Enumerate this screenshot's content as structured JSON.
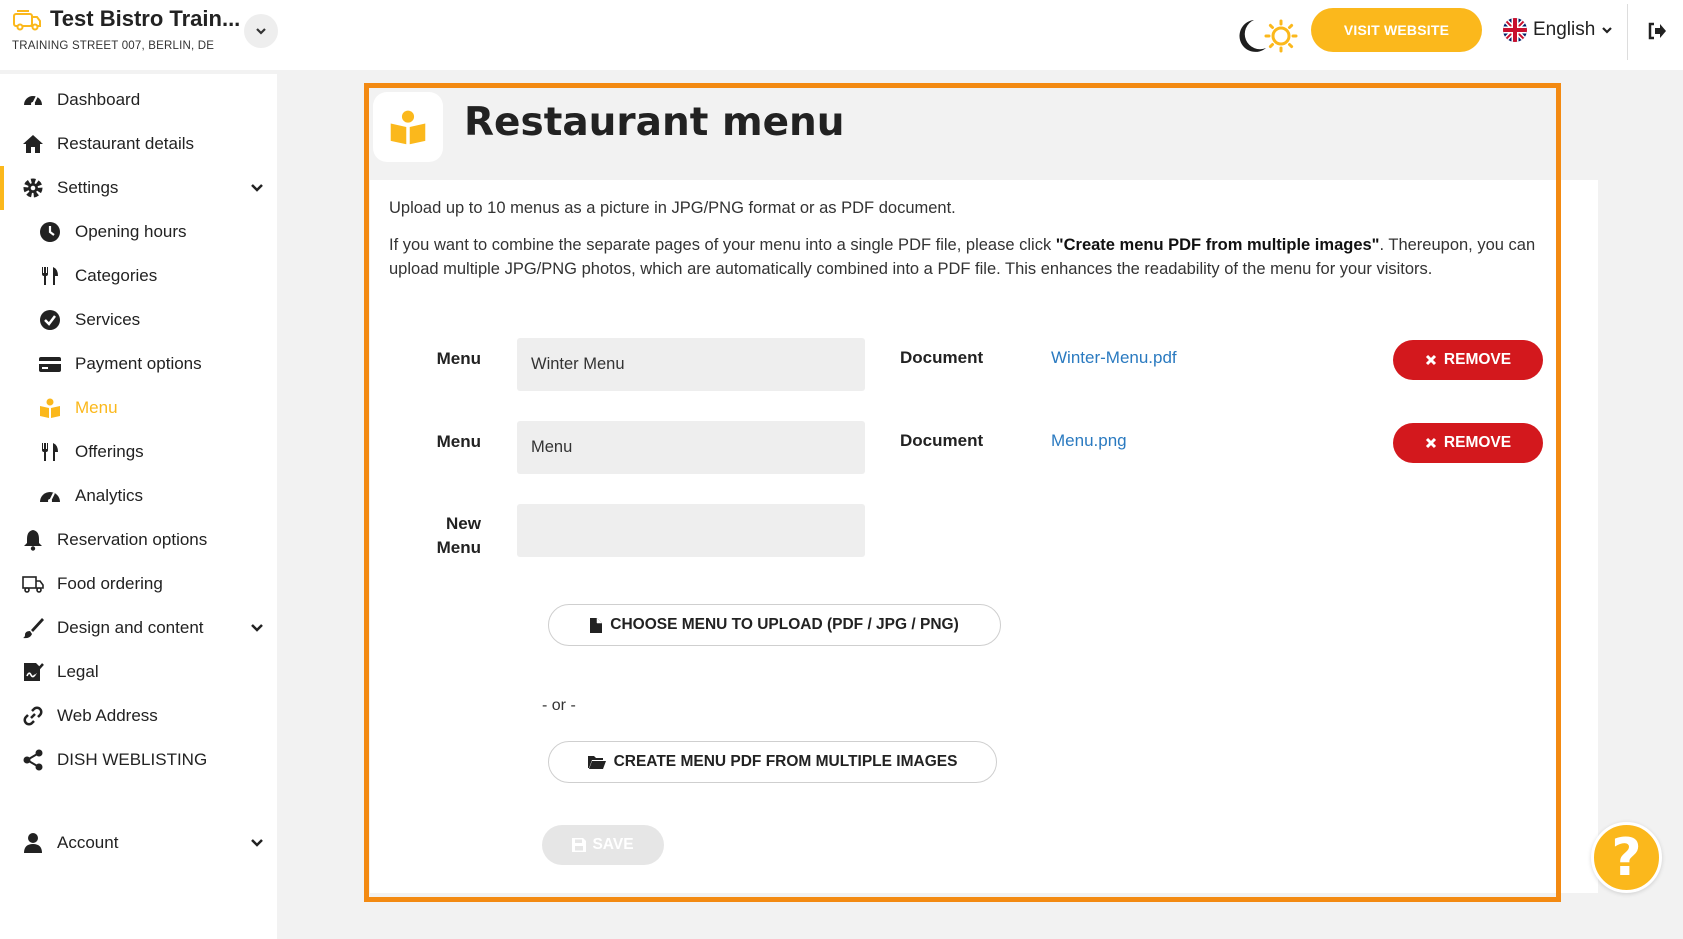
{
  "header": {
    "restaurant_name": "Test Bistro Train...",
    "address": "TRAINING STREET 007, BERLIN, DE",
    "visit_website": "VISIT WEBSITE",
    "language": "English"
  },
  "sidebar": {
    "items": [
      {
        "label": "Dashboard",
        "icon": "dashboard-icon"
      },
      {
        "label": "Restaurant details",
        "icon": "home-icon"
      },
      {
        "label": "Settings",
        "icon": "gear-icon"
      },
      {
        "label": "Opening hours",
        "icon": "clock-icon"
      },
      {
        "label": "Categories",
        "icon": "utensils-icon"
      },
      {
        "label": "Services",
        "icon": "check-circle-icon"
      },
      {
        "label": "Payment options",
        "icon": "credit-card-icon"
      },
      {
        "label": "Menu",
        "icon": "menu-book-icon"
      },
      {
        "label": "Offerings",
        "icon": "utensils-icon"
      },
      {
        "label": "Analytics",
        "icon": "gauge-icon"
      },
      {
        "label": "Reservation options",
        "icon": "bell-icon"
      },
      {
        "label": "Food ordering",
        "icon": "shipping-icon"
      },
      {
        "label": "Design and content",
        "icon": "brush-icon"
      },
      {
        "label": "Legal",
        "icon": "signature-icon"
      },
      {
        "label": "Web Address",
        "icon": "link-icon"
      },
      {
        "label": "DISH WEBLISTING",
        "icon": "share-icon"
      },
      {
        "label": "Account",
        "icon": "user-icon"
      }
    ]
  },
  "main": {
    "title": "Restaurant menu",
    "intro_line1": "Upload up to 10 menus as a picture in JPG/PNG format or as PDF document.",
    "intro_line2_pre": "If you want to combine the separate pages of your menu into a single PDF file, please click ",
    "intro_line2_bold": "\"Create menu PDF from multiple images\"",
    "intro_line2_post": ". Thereupon, you can upload multiple JPG/PNG photos, which are automatically combined into a PDF file. This enhances the readability of the menu for your visitors.",
    "menu_label": "Menu",
    "document_label": "Document",
    "new_menu_label_1": "New",
    "new_menu_label_2": "Menu",
    "menus": [
      {
        "name": "Winter Menu",
        "document": "Winter-Menu.pdf",
        "remove": "REMOVE"
      },
      {
        "name": "Menu",
        "document": "Menu.png",
        "remove": "REMOVE"
      }
    ],
    "new_menu_value": "",
    "choose_upload": "CHOOSE MENU TO UPLOAD (PDF / JPG / PNG)",
    "or": "- or -",
    "create_pdf": "CREATE MENU PDF FROM MULTIPLE IMAGES",
    "save": "SAVE"
  },
  "help": {
    "symbol": "?"
  },
  "colors": {
    "accent": "#fbb81c",
    "remove": "#d3181d",
    "link": "#2a7ac0",
    "highlight": "#f38a12"
  }
}
